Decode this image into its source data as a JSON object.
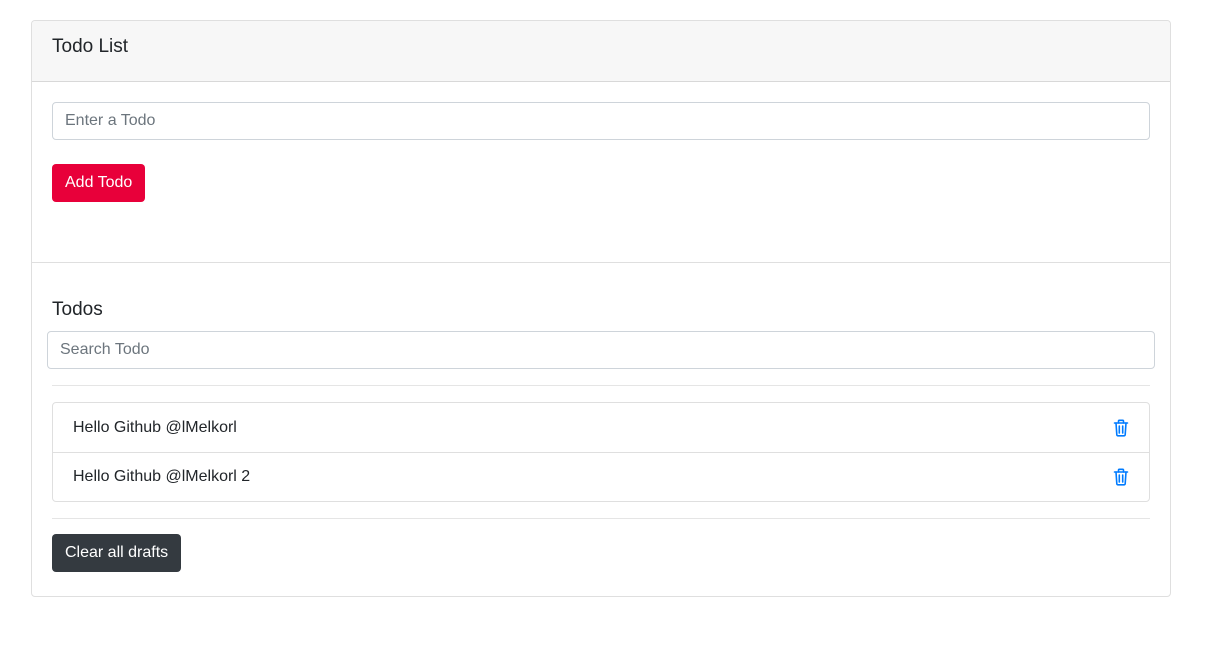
{
  "header": {
    "title": "Todo List"
  },
  "add_form": {
    "input_placeholder": "Enter a Todo",
    "input_value": "",
    "add_label": "Add Todo"
  },
  "todos_section": {
    "title": "Todos",
    "search_placeholder": "Search Todo",
    "search_value": "",
    "items": [
      {
        "text": "Hello Github @lMelkorl",
        "icon": "trash-icon"
      },
      {
        "text": "Hello Github @lMelkorl 2",
        "icon": "trash-icon"
      }
    ],
    "clear_label": "Clear all drafts"
  },
  "colors": {
    "add_button": "#e8003a",
    "clear_button": "#343a40",
    "icon": "#007bff",
    "header_bg": "#f7f7f7"
  }
}
